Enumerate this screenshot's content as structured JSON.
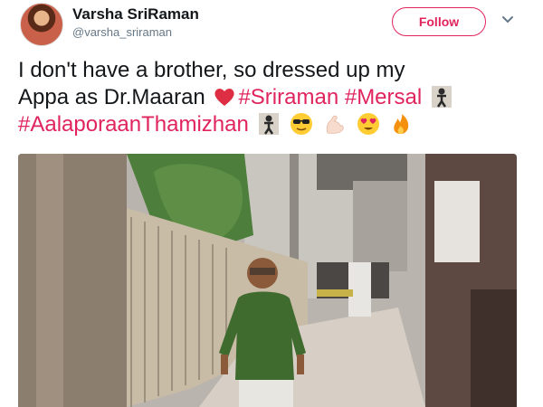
{
  "user": {
    "display_name": "Varsha SriRaman",
    "handle": "@varsha_sriraman"
  },
  "follow_label": "Follow",
  "tweet": {
    "line1": "I don't have a brother, so dressed up my",
    "line2_text": "Appa as Dr.Maaran",
    "hashtags": [
      "#Sriraman",
      "#Mersal",
      "#AalaporaanThamizhan"
    ]
  },
  "icons": {
    "more": "chevron-down-icon",
    "emojis": [
      "red-heart-emoji",
      "man-dancing-emoji",
      "sunglasses-face-emoji",
      "flexed-biceps-emoji",
      "heart-eyes-face-emoji",
      "fire-emoji"
    ]
  },
  "colors": {
    "accent": "#e0245e",
    "text": "#14171a",
    "muted": "#657786"
  }
}
